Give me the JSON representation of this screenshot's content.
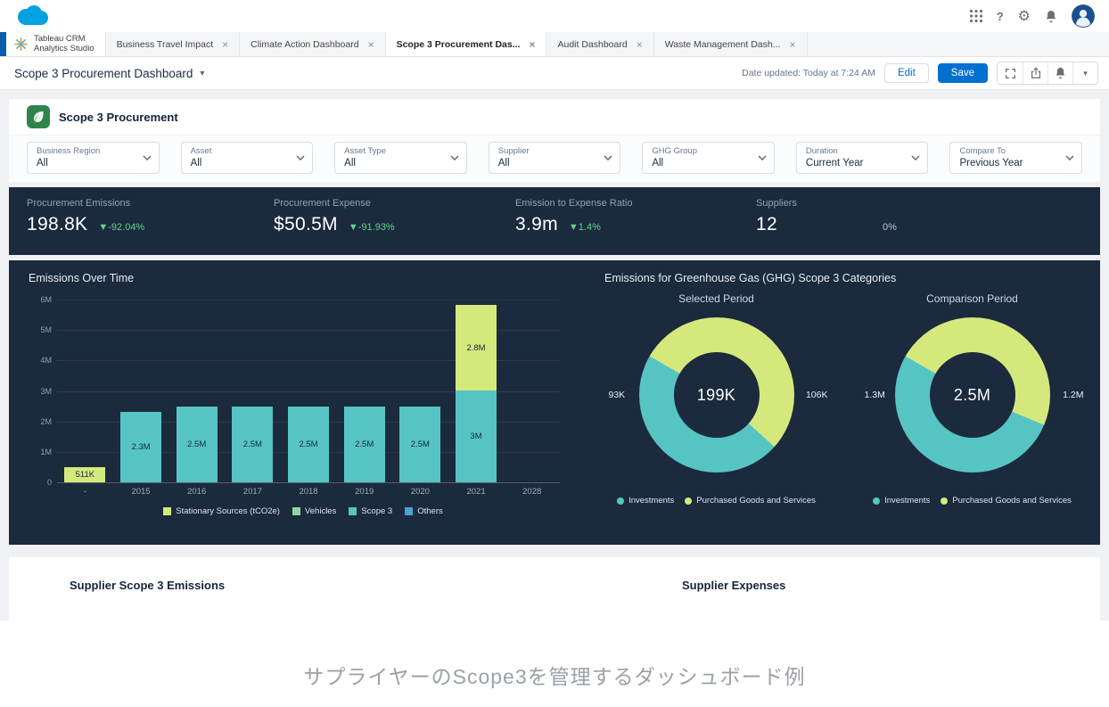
{
  "icons": {
    "close": "×",
    "caret_down": "▾",
    "help": "?",
    "gear": "⚙"
  },
  "colors": {
    "accent": "#0070d2",
    "dark_bg": "#1b2a3d",
    "teal": "#56c4c2",
    "green": "#d5e87c"
  },
  "tab_bar": {
    "app_title_line1": "Tableau CRM",
    "app_title_line2": "Analytics Studio",
    "tabs": [
      {
        "label": "Business Travel Impact",
        "active": false
      },
      {
        "label": "Climate Action Dashboard",
        "active": false
      },
      {
        "label": "Scope 3 Procurement Das...",
        "active": true
      },
      {
        "label": "Audit Dashboard",
        "active": false
      },
      {
        "label": "Waste Management Dash...",
        "active": false
      }
    ]
  },
  "toolbar": {
    "title": "Scope 3 Procurement Dashboard",
    "date_updated": "Date updated: Today at 7:24 AM",
    "edit_label": "Edit",
    "save_label": "Save"
  },
  "dashboard": {
    "header_title": "Scope 3 Procurement",
    "filters": [
      {
        "label": "Business Region",
        "value": "All"
      },
      {
        "label": "Asset",
        "value": "All"
      },
      {
        "label": "Asset Type",
        "value": "All"
      },
      {
        "label": "Supplier",
        "value": "All"
      },
      {
        "label": "GHG Group",
        "value": "All"
      },
      {
        "label": "Duration",
        "value": "Current Year"
      },
      {
        "label": "Compare To",
        "value": "Previous Year"
      }
    ],
    "kpis": [
      {
        "label": "Procurement Emissions",
        "value": "198.8K",
        "delta": "▼-92.04%",
        "delta_color": "#61d68f"
      },
      {
        "label": "Procurement Expense",
        "value": "$50.5M",
        "delta": "▼-91.93%",
        "delta_color": "#61d68f"
      },
      {
        "label": "Emission to Expense Ratio",
        "value": "3.9m",
        "delta": "▼1.4%",
        "delta_color": "#61d68f"
      },
      {
        "label": "Suppliers",
        "value": "12",
        "delta": "0%",
        "delta_color": "#b9c4d0"
      }
    ],
    "bottom_panels": [
      {
        "title": "Supplier Scope 3 Emissions"
      },
      {
        "title": "Supplier Expenses"
      }
    ]
  },
  "caption": "サプライヤーのScope3を管理するダッシュボード例",
  "chart_data": [
    {
      "type": "bar",
      "title": "Emissions Over Time",
      "categories": [
        "-",
        "2015",
        "2016",
        "2017",
        "2018",
        "2019",
        "2020",
        "2021",
        "2028"
      ],
      "series": [
        {
          "name": "Scope 3",
          "color": "#56c4c2",
          "values": [
            0,
            2300000,
            2500000,
            2500000,
            2500000,
            2500000,
            2500000,
            3000000,
            0
          ]
        },
        {
          "name": "Stationary Sources (tCO2e)",
          "color": "#d5e87c",
          "values": [
            511000,
            0,
            0,
            0,
            0,
            0,
            0,
            2800000,
            0
          ]
        }
      ],
      "bar_labels": [
        [
          "",
          "2.3M",
          "2.5M",
          "2.5M",
          "2.5M",
          "2.5M",
          "2.5M",
          "3M",
          ""
        ],
        [
          "511K",
          "",
          "",
          "",
          "",
          "",
          "",
          "2.8M",
          ""
        ]
      ],
      "ylim": [
        0,
        6000000
      ],
      "yticks": [
        "6M",
        "5M",
        "4M",
        "3M",
        "2M",
        "1M",
        "0"
      ],
      "grid": true,
      "legend_position": "bottom",
      "legend": [
        {
          "label": "Stationary Sources (tCO2e)",
          "color": "#d5e87c"
        },
        {
          "label": "Vehicles",
          "color": "#8fd6a4"
        },
        {
          "label": "Scope 3",
          "color": "#56c4c2"
        },
        {
          "label": "Others",
          "color": "#4ba3d4"
        }
      ]
    },
    {
      "type": "pie",
      "title": "Emissions for Greenhouse Gas (GHG) Scope 3 Categories",
      "donuts": [
        {
          "subtitle": "Selected Period",
          "center": "199K",
          "left_label": "93K",
          "right_label": "106K",
          "slices": [
            {
              "label": "Investments",
              "value": 93,
              "color": "#56c4c2"
            },
            {
              "label": "Purchased Goods and Services",
              "value": 106,
              "color": "#d5e87c"
            }
          ]
        },
        {
          "subtitle": "Comparison Period",
          "center": "2.5M",
          "left_label": "1.3M",
          "right_label": "1.2M",
          "slices": [
            {
              "label": "Investments",
              "value": 1.3,
              "color": "#56c4c2"
            },
            {
              "label": "Purchased Goods and Services",
              "value": 1.2,
              "color": "#d5e87c"
            }
          ]
        }
      ],
      "legend": [
        {
          "label": "Investments",
          "color": "#56c4c2"
        },
        {
          "label": "Purchased Goods and Services",
          "color": "#d5e87c"
        }
      ]
    }
  ]
}
